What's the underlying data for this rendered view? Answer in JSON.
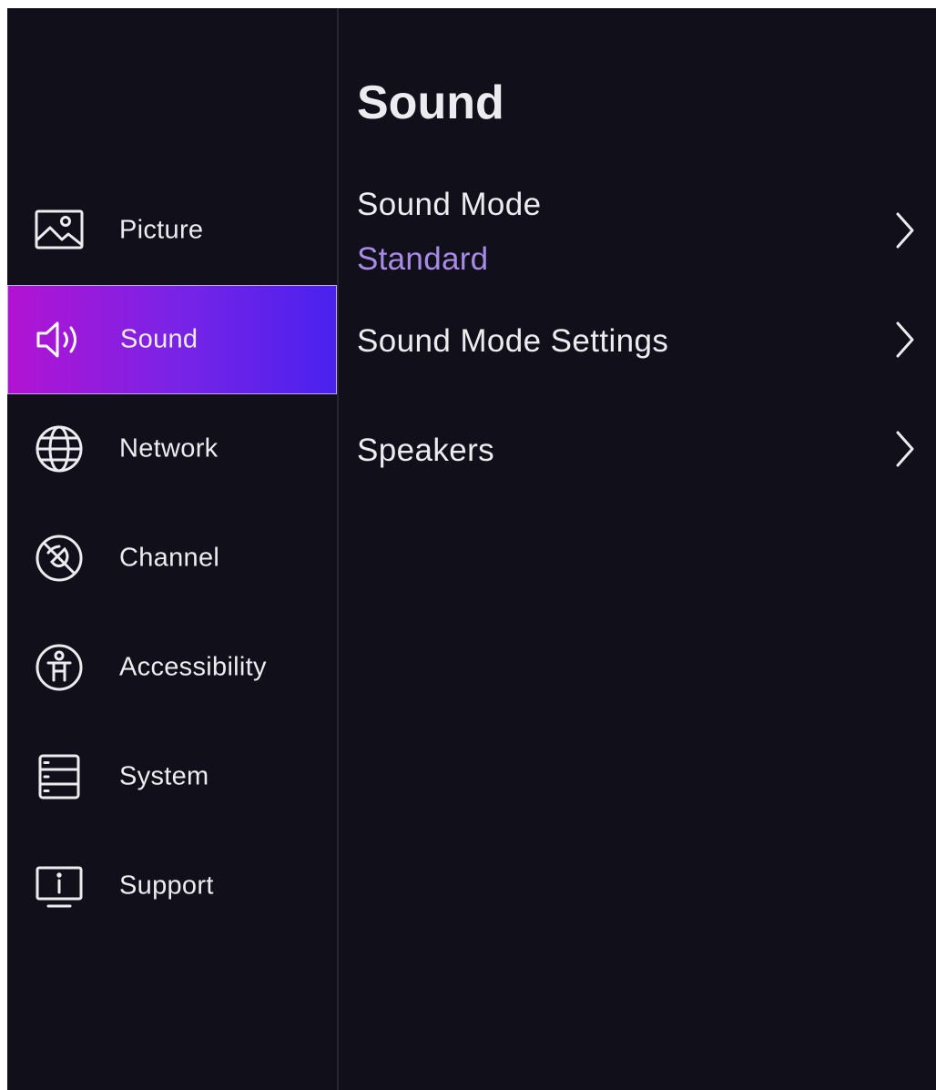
{
  "sidebar": {
    "items": [
      {
        "label": "Picture",
        "icon": "picture-icon",
        "active": false
      },
      {
        "label": "Sound",
        "icon": "speaker-icon",
        "active": true
      },
      {
        "label": "Network",
        "icon": "globe-icon",
        "active": false
      },
      {
        "label": "Channel",
        "icon": "channel-icon",
        "active": false
      },
      {
        "label": "Accessibility",
        "icon": "accessibility-icon",
        "active": false
      },
      {
        "label": "System",
        "icon": "system-icon",
        "active": false
      },
      {
        "label": "Support",
        "icon": "support-icon",
        "active": false
      }
    ]
  },
  "main": {
    "title": "Sound",
    "items": [
      {
        "label": "Sound Mode",
        "value": "Standard",
        "icon": "chevron-right-icon"
      },
      {
        "label": "Sound Mode Settings",
        "icon": "chevron-right-icon"
      },
      {
        "label": "Speakers",
        "icon": "chevron-right-icon"
      }
    ]
  },
  "colors": {
    "background": "#110f19",
    "active_gradient_start": "#b313d2",
    "active_gradient_end": "#4a22ee",
    "text": "#ececf0",
    "value_text": "#a88be6"
  }
}
